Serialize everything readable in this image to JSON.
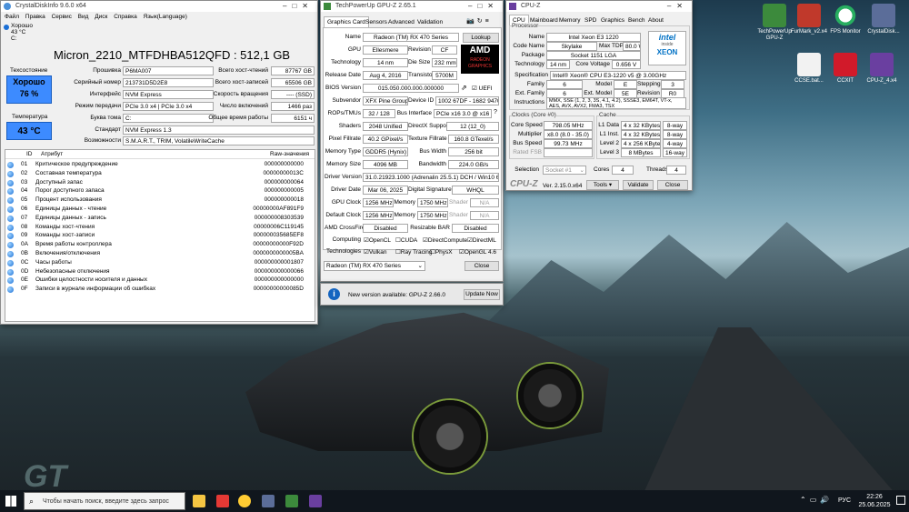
{
  "desktop": {
    "icons": [
      {
        "label": "TechPowerUp GPU-Z",
        "icon": "gpuz-icon",
        "color": "#3c8a3c"
      },
      {
        "label": "FurMark_v2.x4",
        "icon": "furmark-icon",
        "color": "#c0392b"
      },
      {
        "label": "FPS Monitor",
        "icon": "fps-monitor-icon",
        "color": "#27ae60"
      },
      {
        "label": "CrystalDisk...",
        "icon": "crystaldisk-icon",
        "color": "#5b6d99"
      },
      {
        "label": "CCSE.bat...",
        "icon": "file-icon",
        "color": "#f2f2f2"
      },
      {
        "label": "CCXIT",
        "icon": "app-icon",
        "color": "#d11a2a"
      },
      {
        "label": "CPU-Z_4.x4",
        "icon": "cpuz-icon",
        "color": "#6a3fa0"
      }
    ]
  },
  "crystaldisk": {
    "title": "CrystalDiskInfo 9.6.0 x64",
    "menu": [
      "Файл",
      "Правка",
      "Сервис",
      "Вид",
      "Диск",
      "Справка",
      "Язык(Language)"
    ],
    "drive_tab": {
      "status": "Хорошо",
      "temp": "43 °C",
      "letter": "C:"
    },
    "disk_title": "Micron_2210_MTFDHBA512QFD : 512,1 GB",
    "health_label": "Техсостояние",
    "health_status": "Хорошо",
    "health_pct": "76 %",
    "temp_label": "Температура",
    "temp_value": "43 °C",
    "left_fields": [
      {
        "label": "Прошивка",
        "value": "P6MA007"
      },
      {
        "label": "Серийный номер",
        "value": "213731D5D2E8"
      },
      {
        "label": "Интерфейс",
        "value": "NVM Express"
      },
      {
        "label": "Режим передачи",
        "value": "PCIe 3.0 x4 | PCIe 3.0 x4"
      },
      {
        "label": "Буква тома",
        "value": "C:"
      }
    ],
    "right_fields": [
      {
        "label": "Всего хост-чтений",
        "value": "87767 GB"
      },
      {
        "label": "Всего хост-записей",
        "value": "65506 GB"
      },
      {
        "label": "Скорость вращения",
        "value": "---- (SSD)"
      },
      {
        "label": "Число включений",
        "value": "1466 раз"
      },
      {
        "label": "Общее время работы",
        "value": "6151 ч"
      }
    ],
    "standard_label": "Стандарт",
    "standard_value": "NVM Express 1.3",
    "features_label": "Возможности",
    "features_value": "S.M.A.R.T., TRIM, VolatileWriteCache",
    "columns": [
      "ID",
      "Атрибут",
      "Raw-значения"
    ],
    "rows": [
      {
        "id": "01",
        "attr": "Критическое предупреждение",
        "raw": "000000000000"
      },
      {
        "id": "02",
        "attr": "Составная температура",
        "raw": "00000000013C"
      },
      {
        "id": "03",
        "attr": "Доступный запас",
        "raw": "000000000064"
      },
      {
        "id": "04",
        "attr": "Порог доступного запаса",
        "raw": "000000000005"
      },
      {
        "id": "05",
        "attr": "Процент использования",
        "raw": "000000000018"
      },
      {
        "id": "06",
        "attr": "Единицы данных - чтение",
        "raw": "00000000AF891F9"
      },
      {
        "id": "07",
        "attr": "Единицы данных - запись",
        "raw": "000000008303539"
      },
      {
        "id": "08",
        "attr": "Команды хост-чтения",
        "raw": "00000006C119145"
      },
      {
        "id": "09",
        "attr": "Команды хост-записи",
        "raw": "000000035685EF8"
      },
      {
        "id": "0A",
        "attr": "Время работы контроллера",
        "raw": "00000000000F92D"
      },
      {
        "id": "0B",
        "attr": "Включения/отключения",
        "raw": "0000000000005BA"
      },
      {
        "id": "0C",
        "attr": "Часы работы",
        "raw": "000000000001807"
      },
      {
        "id": "0D",
        "attr": "Небезопасные отключения",
        "raw": "000000000000066"
      },
      {
        "id": "0E",
        "attr": "Ошибки целостности носителя и данных",
        "raw": "000000000000000"
      },
      {
        "id": "0F",
        "attr": "Записи в журнале информации об ошибках",
        "raw": "00000000000085D"
      }
    ]
  },
  "gpuz": {
    "title": "TechPowerUp GPU-Z 2.65.1",
    "tabs": [
      "Graphics Card",
      "Sensors",
      "Advanced",
      "Validation"
    ],
    "name_label": "Name",
    "name_value": "Radeon (TM) RX 470 Series",
    "lookup": "Lookup",
    "gpu_label": "GPU",
    "gpu_value": "Ellesmere",
    "revision_label": "Revision",
    "revision_value": "CF",
    "tech_label": "Technology",
    "tech_value": "14 nm",
    "die_label": "Die Size",
    "die_value": "232 mm²",
    "release_label": "Release Date",
    "release_value": "Aug 4, 2016",
    "trans_label": "Transistors",
    "trans_value": "5700M",
    "bios_label": "BIOS Version",
    "bios_value": "015.050.000.000.000000",
    "uefi": "UEFI",
    "subvendor_label": "Subvendor",
    "subvendor_value": "XFX Pine Group",
    "devid_label": "Device ID",
    "devid_value": "1002 67DF - 1682 9470",
    "rops_label": "ROPs/TMUs",
    "rops_value": "32 / 128",
    "bus_label": "Bus Interface",
    "bus_value": "PCIe x16 3.0 @ x16 3.0",
    "shaders_label": "Shaders",
    "shaders_value": "2048 Unified",
    "dx_label": "DirectX Support",
    "dx_value": "12 (12_0)",
    "pixel_label": "Pixel Fillrate",
    "pixel_value": "40.2 GPixel/s",
    "texture_label": "Texture Fillrate",
    "texture_value": "160.8 GTexel/s",
    "memtype_label": "Memory Type",
    "memtype_value": "GDDR5 (Hynix)",
    "buswidth_label": "Bus Width",
    "buswidth_value": "256 bit",
    "memsize_label": "Memory Size",
    "memsize_value": "4096 MB",
    "bandwidth_label": "Bandwidth",
    "bandwidth_value": "224.0 GB/s",
    "driver_label": "Driver Version",
    "driver_value": "31.0.21923.1000 (Adrenalin 25.5.1) DCH / Win10 64",
    "driverdate_label": "Driver Date",
    "driverdate_value": "Mar 06, 2025",
    "sig_label": "Digital Signature",
    "sig_value": "WHQL",
    "gpuclock_label": "GPU Clock",
    "gpuclock_value": "1256 MHz",
    "mem1_label": "Memory",
    "mem1_value": "1750 MHz",
    "shader1_label": "Shader",
    "shader1_value": "N/A",
    "defclock_label": "Default Clock",
    "defclock_value": "1256 MHz",
    "mem2_label": "Memory",
    "mem2_value": "1750 MHz",
    "shader2_label": "Shader",
    "shader2_value": "N/A",
    "crossfire_label": "AMD CrossFire",
    "crossfire_value": "Disabled",
    "rebar_label": "Resizable BAR",
    "rebar_value": "Disabled",
    "computing_label": "Computing",
    "computing": [
      "OpenCL",
      "CUDA",
      "DirectCompute",
      "DirectML"
    ],
    "tech2_label": "Technologies",
    "technologies": [
      "Vulkan",
      "Ray Tracing",
      "PhysX",
      "OpenGL 4.6"
    ],
    "card_select": "Radeon (TM) RX 470 Series",
    "close": "Close",
    "update_text": "New version available: GPU-Z 2.66.0",
    "update_btn": "Update Now",
    "brand": "AMD",
    "brand_sub": "RADEON GRAPHICS"
  },
  "cpuz": {
    "title": "CPU-Z",
    "tabs": [
      "CPU",
      "Mainboard",
      "Memory",
      "SPD",
      "Graphics",
      "Bench",
      "About"
    ],
    "processor_group": "Processor",
    "name_label": "Name",
    "name_value": "Intel Xeon E3 1220",
    "codename_label": "Code Name",
    "codename_value": "Skylake",
    "tdp_label": "Max TDP",
    "tdp_value": "80.0 W",
    "package_label": "Package",
    "package_value": "Socket 1151 LGA",
    "tech_label": "Technology",
    "tech_value": "14 nm",
    "voltage_label": "Core Voltage",
    "voltage_value": "0.656 V",
    "spec_label": "Specification",
    "spec_value": "Intel® Xeon® CPU E3-1220 v5 @ 3.00GHz",
    "family_label": "Family",
    "family_value": "6",
    "model_label": "Model",
    "model_value": "E",
    "stepping_label": "Stepping",
    "stepping_value": "3",
    "extfamily_label": "Ext. Family",
    "extfamily_value": "6",
    "extmodel_label": "Ext. Model",
    "extmodel_value": "5E",
    "revision_label": "Revision",
    "revision_value": "R0",
    "instr_label": "Instructions",
    "instr_value": "MMX, SSE (1, 2, 3, 3S, 4.1, 4.2), SSSE3, EM64T, VT-x, AES, AVX, AVX2, FMA3, TSX",
    "clocks_group": "Clocks (Core #0)",
    "cache_group": "Cache",
    "corespeed_label": "Core Speed",
    "corespeed_value": "798.05 MHz",
    "multi_label": "Multiplier",
    "multi_value": "x8.0 (8.0 - 35.0)",
    "busspeed_label": "Bus Speed",
    "busspeed_value": "99.73 MHz",
    "ratedfsb_label": "Rated FSB",
    "ratedfsb_value": "",
    "cache": [
      {
        "label": "L1 Data",
        "value": "4 x 32 KBytes",
        "way": "8-way"
      },
      {
        "label": "L1 Inst.",
        "value": "4 x 32 KBytes",
        "way": "8-way"
      },
      {
        "label": "Level 2",
        "value": "4 x 256 KBytes",
        "way": "4-way"
      },
      {
        "label": "Level 3",
        "value": "8 MBytes",
        "way": "16-way"
      }
    ],
    "selection_label": "Selection",
    "selection_value": "Socket #1",
    "cores_label": "Cores",
    "cores_value": "4",
    "threads_label": "Threads",
    "threads_value": "4",
    "brand": "CPU-Z",
    "version": "Ver. 2.15.0.x64",
    "tools": "Tools",
    "validate": "Validate",
    "close": "Close",
    "logo_text": "intel",
    "logo_sub": "XEON",
    "logo_tag": "inside"
  },
  "taskbar": {
    "search_placeholder": "Чтобы начать поиск, введите здесь запрос",
    "lang": "РУС",
    "time": "22:26",
    "date": "25.06.2025"
  }
}
